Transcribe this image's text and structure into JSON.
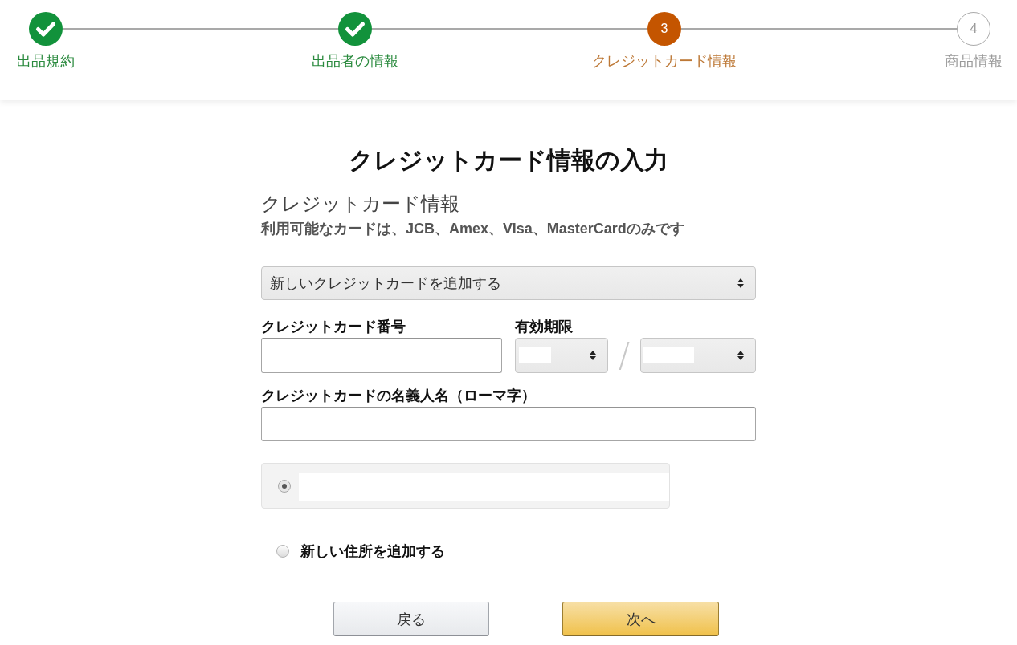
{
  "stepper": {
    "steps": [
      {
        "label": "出品規約",
        "completed": true,
        "current": false
      },
      {
        "label": "出品者の情報",
        "completed": true,
        "current": false
      },
      {
        "number": "3",
        "label": "クレジットカード情報",
        "completed": false,
        "current": true
      },
      {
        "number": "4",
        "label": "商品情報",
        "completed": false,
        "current": false
      }
    ]
  },
  "form": {
    "title": "クレジットカード情報の入力",
    "section_heading": "クレジットカード情報",
    "note": "利用可能なカードは、JCB、Amex、Visa、MasterCardのみです",
    "card_select": {
      "value": "新しいクレジットカードを追加する"
    },
    "card_number": {
      "label": "クレジットカード番号"
    },
    "expiry": {
      "label": "有効期限",
      "separator": "/"
    },
    "cardholder_name": {
      "label": "クレジットカードの名義人名（ローマ字）"
    },
    "addresses": [
      {
        "kind": "saved",
        "selected": true
      },
      {
        "kind": "new",
        "label": "新しい住所を追加する",
        "selected": false
      }
    ],
    "buttons": [
      {
        "label": "戻る",
        "kind": "secondary"
      },
      {
        "label": "次へ",
        "kind": "primary"
      }
    ]
  }
}
